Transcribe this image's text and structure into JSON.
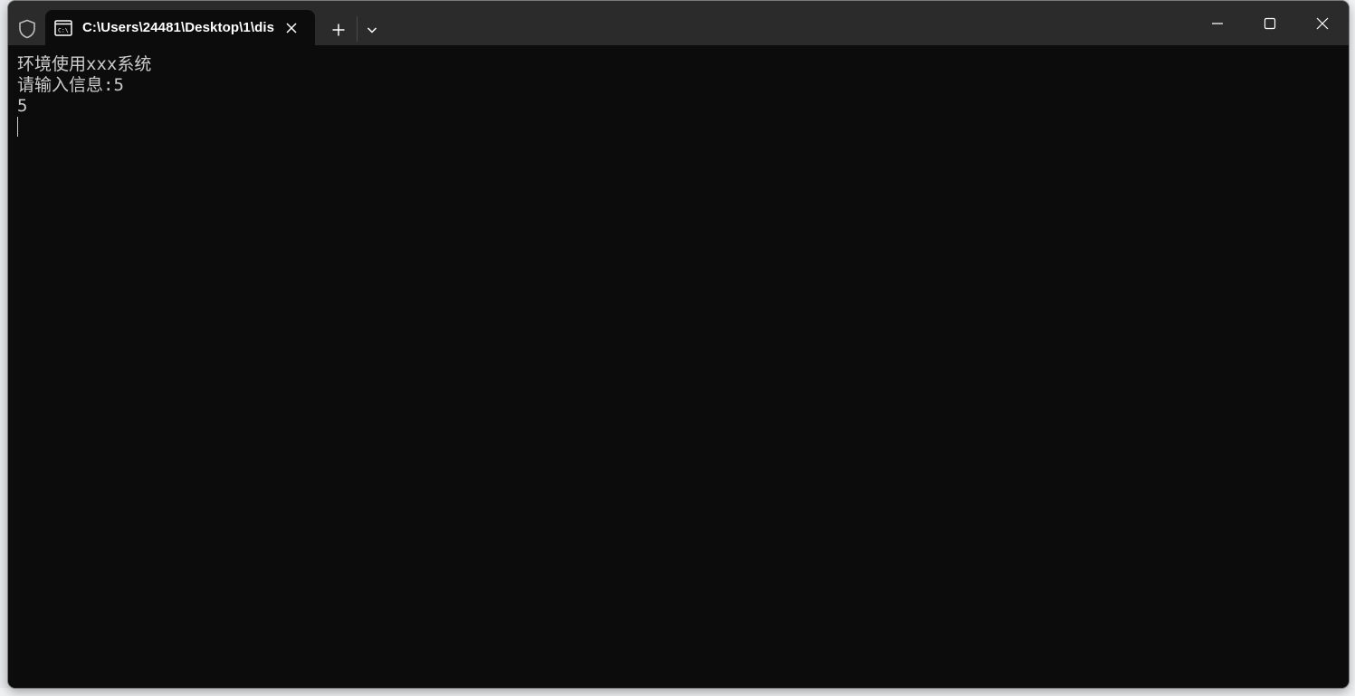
{
  "window": {
    "tab_title": "C:\\Users\\24481\\Desktop\\1\\dis"
  },
  "icons": {
    "shield": "shield-icon",
    "tab": "terminal-icon",
    "tab_close": "close-icon",
    "new_tab": "plus-icon",
    "dropdown": "chevron-down-icon",
    "minimize": "minimize-icon",
    "maximize": "maximize-icon",
    "close": "close-icon"
  },
  "terminal": {
    "lines": [
      "环境使用xxx系统",
      "请输入信息:5",
      "5"
    ]
  },
  "colors": {
    "terminal_bg": "#0c0c0c",
    "titlebar_bg": "#2b2b2b",
    "text": "#cccccc"
  }
}
